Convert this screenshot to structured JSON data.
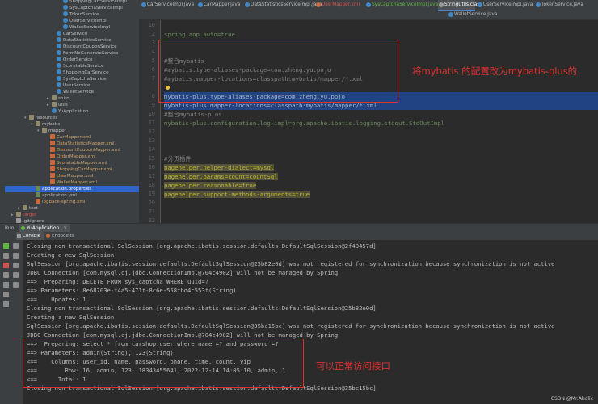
{
  "project_tree": {
    "rows": [
      {
        "label": "ShoppingCartServiceImpl",
        "type": "class",
        "indent": 72,
        "state": ""
      },
      {
        "label": "SysCaptchaServiceImpl",
        "type": "class",
        "indent": 72,
        "state": ""
      },
      {
        "label": "TokenService",
        "type": "class",
        "indent": 72,
        "state": ""
      },
      {
        "label": "UserServiceImpl",
        "type": "class",
        "indent": 72,
        "state": ""
      },
      {
        "label": "WalletServiceImpl",
        "type": "class",
        "indent": 72,
        "state": ""
      },
      {
        "label": "CarService",
        "type": "class",
        "indent": 64,
        "state": ""
      },
      {
        "label": "DataStatisticsService",
        "type": "class",
        "indent": 64,
        "state": ""
      },
      {
        "label": "DiscountCouponService",
        "type": "class",
        "indent": 64,
        "state": ""
      },
      {
        "label": "FormNoGenerateService",
        "type": "class",
        "indent": 64,
        "state": ""
      },
      {
        "label": "OrderService",
        "type": "class",
        "indent": 64,
        "state": ""
      },
      {
        "label": "ScoretableService",
        "type": "class",
        "indent": 64,
        "state": ""
      },
      {
        "label": "ShoppingCarService",
        "type": "class",
        "indent": 64,
        "state": ""
      },
      {
        "label": "SysCaptchaService",
        "type": "class",
        "indent": 64,
        "state": ""
      },
      {
        "label": "UserService",
        "type": "class",
        "indent": 64,
        "state": ""
      },
      {
        "label": "WalletService",
        "type": "class",
        "indent": 64,
        "state": ""
      },
      {
        "label": "shiro",
        "type": "folder",
        "indent": 58,
        "state": "collapsed"
      },
      {
        "label": "utils",
        "type": "folder",
        "indent": 58,
        "state": "collapsed"
      },
      {
        "label": "YuApplication",
        "type": "class",
        "indent": 58,
        "state": ""
      },
      {
        "label": "resources",
        "type": "folder",
        "indent": 30,
        "state": "expanded"
      },
      {
        "label": "mybatis",
        "type": "folder",
        "indent": 38,
        "state": "expanded"
      },
      {
        "label": "mapper",
        "type": "folder",
        "indent": 46,
        "state": "expanded"
      },
      {
        "label": "CarMapper.xml",
        "type": "xml",
        "indent": 56,
        "state": ""
      },
      {
        "label": "DataStatisticsMapper.xml",
        "type": "xml",
        "indent": 56,
        "state": ""
      },
      {
        "label": "DiscountCouponMapper.xml",
        "type": "xml",
        "indent": 56,
        "state": ""
      },
      {
        "label": "OrderMapper.xml",
        "type": "xml",
        "indent": 56,
        "state": ""
      },
      {
        "label": "ScoretableMapper.xml",
        "type": "xml",
        "indent": 56,
        "state": ""
      },
      {
        "label": "ShoppingCarMapper.xml",
        "type": "xml",
        "indent": 56,
        "state": ""
      },
      {
        "label": "UserMapper.xml",
        "type": "xml",
        "indent": 56,
        "state": ""
      },
      {
        "label": "WalletMapper.xml",
        "type": "xml",
        "indent": 56,
        "state": ""
      },
      {
        "label": "application.properties",
        "type": "yml",
        "indent": 38,
        "state": "selected"
      },
      {
        "label": "application.yml",
        "type": "yml",
        "indent": 38,
        "state": ""
      },
      {
        "label": "logback-spring.xml",
        "type": "xml",
        "indent": 38,
        "state": ""
      },
      {
        "label": "test",
        "type": "folder",
        "indent": 22,
        "state": "collapsed"
      },
      {
        "label": "target",
        "type": "folder",
        "indent": 14,
        "state": "collapsed"
      },
      {
        "label": ".gitignore",
        "type": "file",
        "indent": 14,
        "state": ""
      }
    ]
  },
  "editor_tabs": {
    "row1": [
      {
        "label": "CarServiceImpl.java",
        "color": "#3f88c5",
        "style": "normal"
      },
      {
        "label": "CarMapper.java",
        "color": "#3f88c5",
        "style": "normal"
      },
      {
        "label": "DataStatisticsServiceImpl.java",
        "color": "#3f88c5",
        "style": "normal"
      },
      {
        "label": "UserMapper.xml",
        "color": "#c86a3a",
        "style": "red"
      },
      {
        "label": "SysCaptchaServiceImpl.java",
        "color": "#3f88c5",
        "style": "green"
      },
      {
        "label": "StringUtils.class",
        "color": "#9a9a9a",
        "style": "active"
      },
      {
        "label": "UserServiceImpl.java",
        "color": "#3f88c5",
        "style": "normal"
      },
      {
        "label": "TokenService.java",
        "color": "#3f88c5",
        "style": "normal"
      }
    ],
    "row2": [
      {
        "label": "WalletService.java",
        "color": "#3f88c5",
        "style": "normal"
      }
    ]
  },
  "editor": {
    "lines": [
      {
        "num": "10",
        "text": "",
        "cls": ""
      },
      {
        "num": "2",
        "text": "spring.aop.auto=true",
        "cls": "kv"
      },
      {
        "num": "3",
        "text": "",
        "cls": ""
      },
      {
        "num": "4",
        "text": "",
        "cls": ""
      },
      {
        "num": "5",
        "text": "#整合mybatis",
        "cls": "c"
      },
      {
        "num": "6",
        "text": "#mybatis.type-aliases-package=com.zheng.yu.pojo",
        "cls": "c"
      },
      {
        "num": "7",
        "text": "#mybatis.mapper-locations=classpath:mybatis/mapper/*.xml",
        "cls": "c"
      },
      {
        "num": "",
        "text": "",
        "cls": "bulb"
      },
      {
        "num": "8",
        "text": "mybatis-plus.type-aliases-package=com.zheng.yu.pojo",
        "cls": "hl"
      },
      {
        "num": "9",
        "text": "mybatis-plus.mapper-locations=classpath:mybatis/mapper/*.xml",
        "cls": "hl"
      },
      {
        "num": "10",
        "text": "#整合mybatis-plus",
        "cls": "c"
      },
      {
        "num": "11",
        "text": "mybatis-plus.configuration.log-impl=org.apache.ibatis.logging.stdout.StdOutImpl",
        "cls": "kv"
      },
      {
        "num": "12",
        "text": "",
        "cls": ""
      },
      {
        "num": "13",
        "text": "",
        "cls": ""
      },
      {
        "num": "14",
        "text": "",
        "cls": ""
      },
      {
        "num": "15",
        "text": "#分页插件",
        "cls": "c"
      },
      {
        "num": "16",
        "text": "pagehelper.helper-dialect=mysql",
        "cls": "ph"
      },
      {
        "num": "17",
        "text": "pagehelper.params=count=countSql",
        "cls": "ph"
      },
      {
        "num": "18",
        "text": "pagehelper.reasonable=true",
        "cls": "ph"
      },
      {
        "num": "19",
        "text": "pagehelper.support-methods-arguments=true",
        "cls": "ph"
      },
      {
        "num": "20",
        "text": "",
        "cls": ""
      },
      {
        "num": "21",
        "text": "",
        "cls": ""
      },
      {
        "num": "22",
        "text": "",
        "cls": ""
      }
    ]
  },
  "annotations": {
    "top": "将mybatis 的配置改为mybatis-plus的",
    "bottom": "可以正常访问接口"
  },
  "run_panel": {
    "run_label": "Run:",
    "app_tab": "YuApplication",
    "close_glyph": "×",
    "tabs": [
      "Console",
      "Endpoints"
    ],
    "lines": [
      "Closing non transactional SqlSession [org.apache.ibatis.session.defaults.DefaultSqlSession@2f40457d]",
      "Creating a new SqlSession",
      "SqlSession [org.apache.ibatis.session.defaults.DefaultSqlSession@25b82e0d] was not registered for synchronization because synchronization is not active",
      "JDBC Connection [com.mysql.cj.jdbc.ConnectionImpl@704c4902] will not be managed by Spring",
      "==>  Preparing: DELETE FROM sys_captcha WHERE uuid=?",
      "==> Parameters: 8e68703e-f4a5-471f-8c6e-558fbd4c553f(String)",
      "<==    Updates: 1",
      "Closing non transactional SqlSession [org.apache.ibatis.session.defaults.DefaultSqlSession@25b82e0d]",
      "Creating a new SqlSession",
      "SqlSession [org.apache.ibatis.session.defaults.DefaultSqlSession@35bc15bc] was not registered for synchronization because synchronization is not active",
      "JDBC Connection [com.mysql.cj.jdbc.ConnectionImpl@704c4902] will not be managed by Spring",
      "==>  Preparing: select * from carshop.user where name =? and password =?",
      "==> Parameters: admin(String), 123(String)",
      "<==    Columns: user_id, name, password, phone, time, count, vip",
      "<==        Row: 16, admin, 123, 18343455641, 2022-12-14 14:05:10, admin, 1",
      "<==      Total: 1",
      "Closing non transactional SqlSession [org.apache.ibatis.session.defaults.DefaultSqlSession@35bc15bc]"
    ]
  },
  "watermark": "CSDN @Mr.Aholic"
}
